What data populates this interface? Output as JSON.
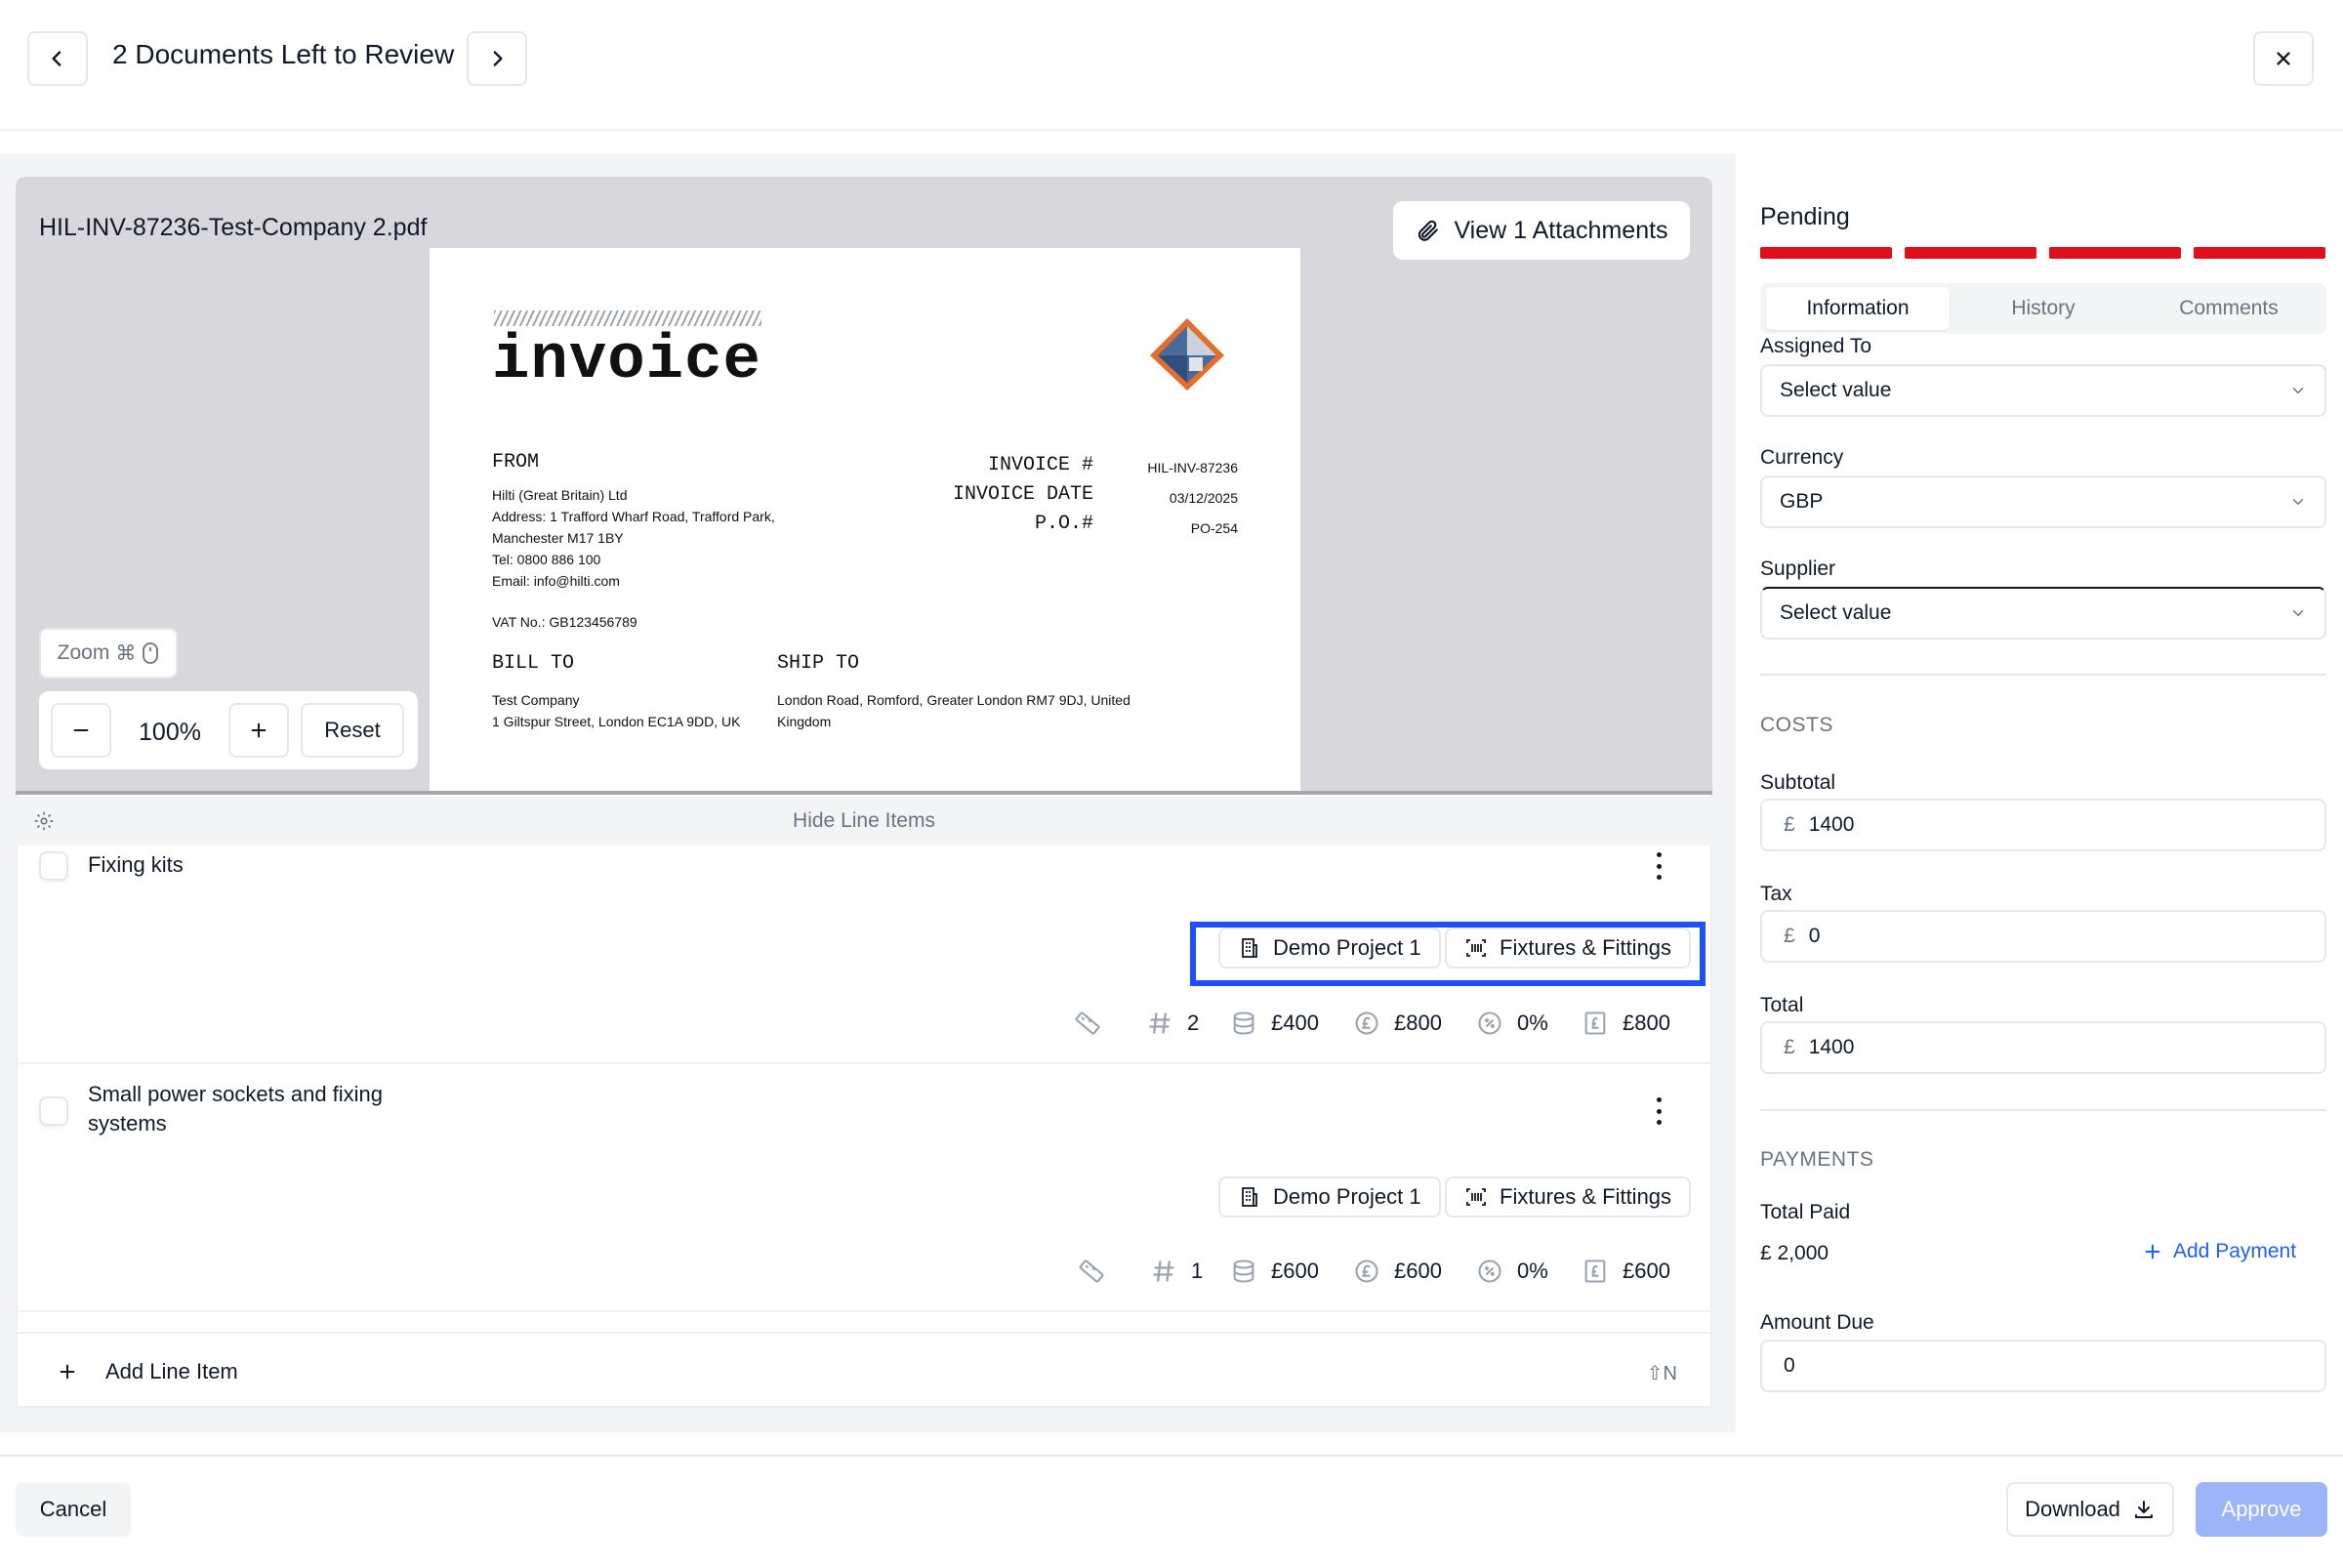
{
  "header": {
    "title": "2 Documents Left to Review"
  },
  "document": {
    "filename": "HIL-INV-87236-Test-Company 2.pdf",
    "attachments_label": "View 1 Attachments",
    "invoice": {
      "heading": "invoice",
      "from_label": "FROM",
      "from_lines": [
        "Hilti (Great Britain) Ltd",
        "Address: 1 Trafford Wharf Road, Trafford Park,",
        "Manchester M17 1BY",
        "Tel: 0800 886 100",
        "Email: info@hilti.com"
      ],
      "vat": "VAT No.: GB123456789",
      "meta_labels": [
        "INVOICE #",
        "INVOICE DATE",
        "P.O.#"
      ],
      "meta_values": [
        "HIL-INV-87236",
        "03/12/2025",
        "PO-254"
      ],
      "bill_to_label": "BILL TO",
      "bill_to_lines": [
        "Test Company",
        "1 Giltspur Street, London EC1A 9DD, UK"
      ],
      "ship_to_label": "SHIP TO",
      "ship_to_lines": [
        "London Road, Romford, Greater London RM7 9DJ, United",
        "Kingdom"
      ]
    },
    "zoom": {
      "label": "Zoom",
      "shortcut": "⌘",
      "level": "100%",
      "reset": "Reset"
    }
  },
  "line_items": {
    "hide_label": "Hide Line Items",
    "add_label": "Add Line Item",
    "add_shortcut": "⇧N",
    "items": [
      {
        "title": "Fixing kits",
        "project": "Demo Project 1",
        "category": "Fixtures & Fittings",
        "quantity": "2",
        "unit_price": "£400",
        "net": "£800",
        "tax_rate": "0%",
        "total": "£800"
      },
      {
        "title_line1": "Small power sockets and fixing",
        "title_line2": "systems",
        "project": "Demo Project 1",
        "category": "Fixtures & Fittings",
        "quantity": "1",
        "unit_price": "£600",
        "net": "£600",
        "tax_rate": "0%",
        "total": "£600"
      }
    ]
  },
  "sidebar": {
    "status": "Pending",
    "status_color": "#e00f1b",
    "tabs": [
      "Information",
      "History",
      "Comments"
    ],
    "assigned_to": {
      "label": "Assigned To",
      "value": "Select value"
    },
    "currency": {
      "label": "Currency",
      "value": "GBP"
    },
    "supplier": {
      "label": "Supplier",
      "value": "Select value"
    },
    "costs": {
      "heading": "COSTS",
      "currency_symbol": "£",
      "subtotal_label": "Subtotal",
      "subtotal": "1400",
      "tax_label": "Tax",
      "tax": "0",
      "total_label": "Total",
      "total": "1400"
    },
    "payments": {
      "heading": "PAYMENTS",
      "total_paid_label": "Total Paid",
      "total_paid": "£ 2,000",
      "add_payment": "Add Payment",
      "amount_due_label": "Amount Due",
      "amount_due": "0"
    }
  },
  "footer": {
    "cancel": "Cancel",
    "download": "Download",
    "approve": "Approve"
  },
  "accent_color": "#1e4fff"
}
